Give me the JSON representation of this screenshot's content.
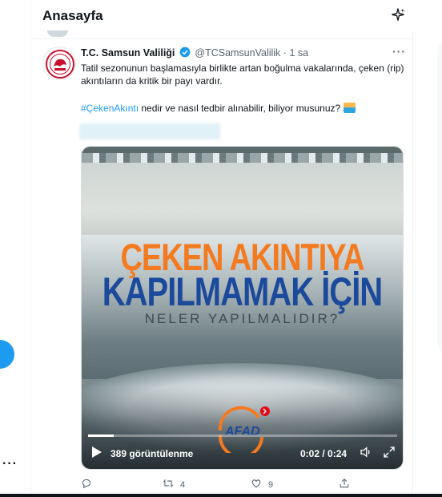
{
  "header": {
    "title": "Anasayfa",
    "sparkle_icon": "sparkle-icon"
  },
  "tweet": {
    "author_name": "T.C. Samsun Valiliği",
    "handle": "@TCSamsunValilik",
    "separator": "·",
    "time": "1 sa",
    "text_line1": "Tatil sezonunun başlamasıyla birlikte artan boğulma vakalarında, çeken (rip) akıntıların da kritik bir payı vardır.",
    "hashtag": "#ÇekenAkıntı",
    "text_line2": " nedir ve nasıl tedbir alınabilir, biliyor musunuz?",
    "emoji": "swimmer-emoji"
  },
  "video": {
    "overlay_line1": "ÇEKEN AKINTIYA",
    "overlay_line2": "KAPILMAMAK İÇİN",
    "overlay_line3": "NELER YAPILMALIDIR?",
    "logo_text": "AFAD",
    "views": "389 görüntülenme",
    "time_display": "0:02 / 0:24",
    "progress": 0.083
  },
  "actions": {
    "reply_count": "",
    "retweet_count": "4",
    "like_count": "9"
  },
  "colors": {
    "accent": "#1d9bf0",
    "overlay_orange": "#f47a20",
    "overlay_blue": "#1b4a9c"
  }
}
